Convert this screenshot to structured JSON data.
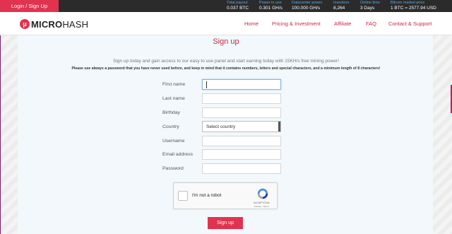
{
  "topbar": {
    "login_label": "Login / Sign Up",
    "stats": [
      {
        "label": "Total payout",
        "value": "0.037 BTC"
      },
      {
        "label": "Power in use",
        "value": "0.301 GH/s"
      },
      {
        "label": "Datacenter power",
        "value": "100.000 GH/s"
      },
      {
        "label": "Investors",
        "value": "8,264"
      },
      {
        "label": "Online time",
        "value": "3 Days"
      },
      {
        "label": "Bitcoin market price",
        "value": "1 BTC = 2577.94 USD"
      }
    ]
  },
  "header": {
    "logo_mark": "μ",
    "logo_bold": "MICRO",
    "logo_thin": "HASH",
    "nav": [
      "Home",
      "Pricing & Investment",
      "Affiliate",
      "FAQ",
      "Contact & Support"
    ]
  },
  "form": {
    "title": "Sign up",
    "intro": "Sign up today and gain access to our easy to use panel and start earning today with 15KH/s free mining power!",
    "note": "Please use always a password that you have never used before, and keep in mind that it contains numbers, letters and special characters, and a minimum length of 8 characters!",
    "labels": {
      "first_name": "First name",
      "last_name": "Last name",
      "birthday": "Birthday",
      "country": "Country",
      "username": "Username",
      "email": "Email address",
      "password": "Password"
    },
    "country_value": "Select country",
    "captcha": {
      "text": "I'm not a robot",
      "brand": "reCAPTCHA",
      "terms": "Privacy - Terms"
    },
    "submit_label": "Sign up"
  },
  "colors": {
    "accent": "#e0334f",
    "nav_text": "#c8284b",
    "stat_label": "#4fb0e8",
    "topbar_bg": "#2b2b2b"
  }
}
